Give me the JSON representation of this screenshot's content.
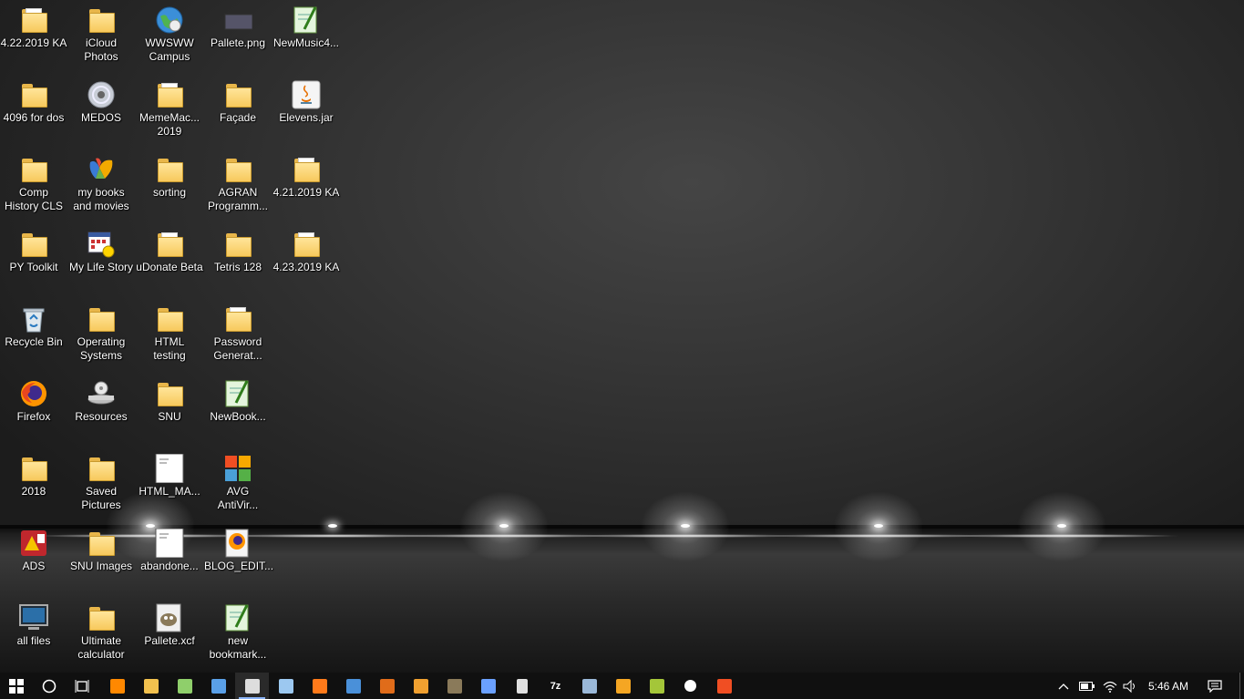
{
  "desktop": {
    "icons": [
      {
        "label": "4.22.2019 KA",
        "type": "folder-doc",
        "col": 0,
        "row": 0
      },
      {
        "label": "iCloud\nPhotos",
        "type": "folder",
        "col": 1,
        "row": 0
      },
      {
        "label": "WWSWW\nCampus",
        "type": "globe",
        "col": 2,
        "row": 0
      },
      {
        "label": "Pallete.png",
        "type": "image",
        "col": 3,
        "row": 0
      },
      {
        "label": "NewMusic4...",
        "type": "notepadpp",
        "col": 4,
        "row": 0
      },
      {
        "label": "4096 for dos",
        "type": "folder",
        "col": 0,
        "row": 1
      },
      {
        "label": "MEDOS",
        "type": "disc",
        "col": 1,
        "row": 1
      },
      {
        "label": "MemeMac...\n2019",
        "type": "folder-doc",
        "col": 2,
        "row": 1
      },
      {
        "label": "Façade",
        "type": "folder",
        "col": 3,
        "row": 1
      },
      {
        "label": "Elevens.jar",
        "type": "java",
        "col": 4,
        "row": 1
      },
      {
        "label": "Comp\nHistory CLS",
        "type": "folder",
        "col": 0,
        "row": 2
      },
      {
        "label": "my books\nand movies",
        "type": "msn",
        "col": 1,
        "row": 2
      },
      {
        "label": "sorting",
        "type": "folder",
        "col": 2,
        "row": 2
      },
      {
        "label": "AGRAN\nProgramm...",
        "type": "folder",
        "col": 3,
        "row": 2
      },
      {
        "label": "4.21.2019 KA",
        "type": "folder-doc",
        "col": 4,
        "row": 2
      },
      {
        "label": "PY Toolkit",
        "type": "folder",
        "col": 0,
        "row": 3
      },
      {
        "label": "My Life Story",
        "type": "calendar",
        "col": 1,
        "row": 3
      },
      {
        "label": "uDonate Beta",
        "type": "folder-doc",
        "col": 2,
        "row": 3
      },
      {
        "label": "Tetris 128",
        "type": "folder",
        "col": 3,
        "row": 3
      },
      {
        "label": "4.23.2019 KA",
        "type": "folder-doc",
        "col": 4,
        "row": 3
      },
      {
        "label": "Recycle Bin",
        "type": "recycle",
        "col": 0,
        "row": 4
      },
      {
        "label": "Operating\nSystems",
        "type": "folder",
        "col": 1,
        "row": 4
      },
      {
        "label": "HTML\ntesting",
        "type": "folder",
        "col": 2,
        "row": 4
      },
      {
        "label": "Password\nGenerat...",
        "type": "folder-doc",
        "col": 3,
        "row": 4
      },
      {
        "label": "Firefox",
        "type": "firefox",
        "col": 0,
        "row": 5
      },
      {
        "label": "Resources",
        "type": "drive",
        "col": 1,
        "row": 5
      },
      {
        "label": "SNU",
        "type": "folder",
        "col": 2,
        "row": 5
      },
      {
        "label": "NewBook...",
        "type": "notepadpp",
        "col": 3,
        "row": 5
      },
      {
        "label": "2018",
        "type": "folder",
        "col": 0,
        "row": 6
      },
      {
        "label": "Saved\nPictures",
        "type": "folder",
        "col": 1,
        "row": 6
      },
      {
        "label": "HTML_MA...",
        "type": "doc",
        "col": 2,
        "row": 6
      },
      {
        "label": "AVG\nAntiVir...",
        "type": "avg",
        "col": 3,
        "row": 6
      },
      {
        "label": "ADS",
        "type": "ads",
        "col": 0,
        "row": 7
      },
      {
        "label": "SNU Images",
        "type": "folder",
        "col": 1,
        "row": 7
      },
      {
        "label": "abandone...",
        "type": "doc",
        "col": 2,
        "row": 7
      },
      {
        "label": "BLOG_EDIT...",
        "type": "firefox-doc",
        "col": 3,
        "row": 7
      },
      {
        "label": "all files",
        "type": "monitor",
        "col": 0,
        "row": 8
      },
      {
        "label": "Ultimate\ncalculator",
        "type": "folder",
        "col": 1,
        "row": 8
      },
      {
        "label": "Pallete.xcf",
        "type": "gimp",
        "col": 2,
        "row": 8
      },
      {
        "label": "new\nbookmark...",
        "type": "notepadpp",
        "col": 3,
        "row": 8
      }
    ]
  },
  "taskbar": {
    "start_label": "Start",
    "search_label": "Search",
    "task_view_label": "Task View",
    "pinned": [
      {
        "name": "vlc",
        "color": "#ff8800"
      },
      {
        "name": "file-explorer",
        "color": "#f2c14e"
      },
      {
        "name": "notepadpp",
        "color": "#8fcf6b"
      },
      {
        "name": "photos",
        "color": "#5aa0e8"
      },
      {
        "name": "panda",
        "color": "#dddddd",
        "active": true
      },
      {
        "name": "notepad",
        "color": "#9cc8f0"
      },
      {
        "name": "firefox",
        "color": "#ff7a1a"
      },
      {
        "name": "monitor-app",
        "color": "#4a90d9"
      },
      {
        "name": "film",
        "color": "#e06c1a"
      },
      {
        "name": "notes",
        "color": "#f0a030"
      },
      {
        "name": "gimp",
        "color": "#8a7a5a"
      },
      {
        "name": "chrome-like",
        "color": "#6aa0ff"
      },
      {
        "name": "calculator",
        "color": "#e0e0e0"
      },
      {
        "name": "7zip",
        "color": "#cccccc"
      },
      {
        "name": "cloud",
        "color": "#9ab8d8"
      },
      {
        "name": "java",
        "color": "#f5a623"
      },
      {
        "name": "leaf",
        "color": "#a4c639"
      },
      {
        "name": "settings",
        "color": "#ffffff"
      },
      {
        "name": "avg",
        "color": "#f04e23"
      }
    ],
    "seven_zip_label": "7z",
    "tray": {
      "clock": "5:46 AM"
    }
  },
  "colors": {
    "taskbar_bg": "#101010",
    "folder": "#f7c95c"
  }
}
